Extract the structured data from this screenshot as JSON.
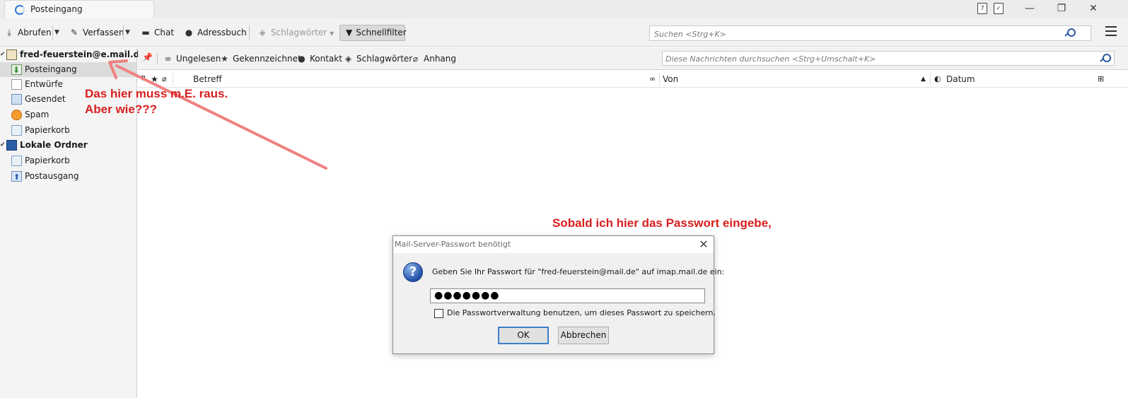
{
  "tab": {
    "title": "Posteingang"
  },
  "window_controls": {
    "minimize": "—",
    "restore": "❐",
    "close": "✕"
  },
  "toolbar": {
    "get_mail": "Abrufen",
    "compose": "Verfassen",
    "chat": "Chat",
    "address_book": "Adressbuch",
    "tags": "Schlagwörter",
    "quick_filter": "Schnellfilter",
    "search_placeholder": "Suchen <Strg+K>"
  },
  "folders": [
    {
      "label": "fred-feuerstein@e.mail.de",
      "type": "account",
      "icon": "mail-account-icon"
    },
    {
      "label": "Posteingang",
      "type": "folder",
      "icon": "inbox-icon",
      "selected": true
    },
    {
      "label": "Entwürfe",
      "type": "folder",
      "icon": "drafts-icon"
    },
    {
      "label": "Gesendet",
      "type": "folder",
      "icon": "sent-icon"
    },
    {
      "label": "Spam",
      "type": "folder",
      "icon": "spam-icon"
    },
    {
      "label": "Papierkorb",
      "type": "folder",
      "icon": "trash-icon"
    },
    {
      "label": "Lokale Ordner",
      "type": "account",
      "icon": "local-folders-icon"
    },
    {
      "label": "Papierkorb",
      "type": "folder",
      "icon": "trash-icon"
    },
    {
      "label": "Postausgang",
      "type": "folder",
      "icon": "outbox-icon"
    }
  ],
  "quick_filter_bar": {
    "unread": "Ungelesen",
    "starred": "Gekennzeichnet",
    "contact": "Kontakt",
    "tags": "Schlagwörter",
    "attachment": "Anhang",
    "search_placeholder": "Diese Nachrichten durchsuchen <Strg+Umschalt+K>"
  },
  "columns": {
    "subject": "Betreff",
    "from": "Von",
    "date": "Datum"
  },
  "annotations": {
    "line1": "Das hier muss m.E. raus.",
    "line2": "Aber wie???",
    "line3": "Sobald ich hier das Passwort eingebe,"
  },
  "dialog": {
    "title": "Mail-Server-Passwort benötigt",
    "message": "Geben Sie Ihr Passwort für \"fred-feuerstein@mail.de\" auf imap.mail.de ein:",
    "password_mask": "●●●●●●●",
    "save_label": "Die Passwortverwaltung benutzen, um dieses Passwort zu speichern.",
    "ok": "OK",
    "cancel": "Abbrechen"
  },
  "colors": {
    "annotation": "#d81f1f",
    "arrow": "#f08080",
    "accent": "#3c7fc8"
  }
}
